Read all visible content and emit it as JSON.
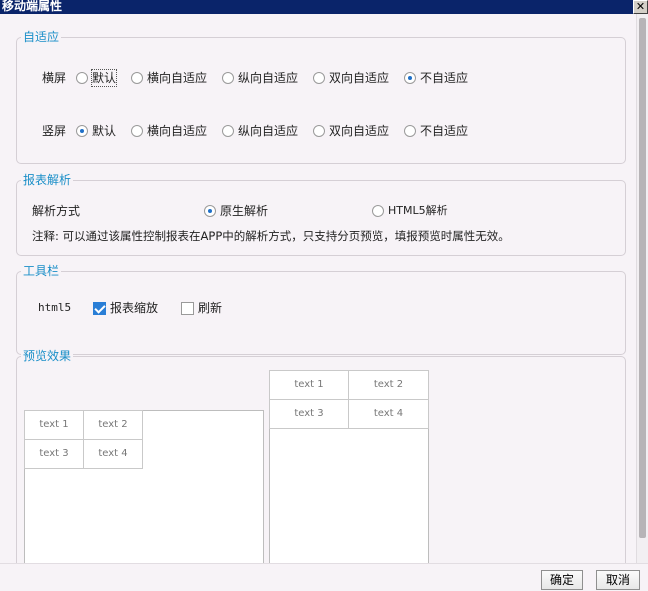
{
  "window": {
    "title": "移动端属性",
    "close_glyph": "✕"
  },
  "adaptive": {
    "title": "自适应",
    "landscape": {
      "label": "横屏",
      "options": [
        "默认",
        "横向自适应",
        "纵向自适应",
        "双向自适应",
        "不自适应"
      ],
      "selected": "不自适应"
    },
    "portrait": {
      "label": "竖屏",
      "options": [
        "默认",
        "横向自适应",
        "纵向自适应",
        "双向自适应",
        "不自适应"
      ],
      "selected": "默认"
    }
  },
  "parse": {
    "title": "报表解析",
    "method_label": "解析方式",
    "options": [
      "原生解析",
      "HTML5解析"
    ],
    "selected": "原生解析",
    "note": "注释: 可以通过该属性控制报表在APP中的解析方式，只支持分页预览，填报预览时属性无效。"
  },
  "toolbar": {
    "title": "工具栏",
    "html5_label": "html5",
    "zoom_label": "报表缩放",
    "zoom_checked": true,
    "refresh_label": "刷新",
    "refresh_checked": false
  },
  "preview": {
    "title": "预览效果",
    "left_cells": [
      "text 1",
      "text 2",
      "text 3",
      "text 4"
    ],
    "right_cells": [
      "text 1",
      "text 2",
      "text 3",
      "text 4"
    ]
  },
  "footer": {
    "ok_label": "确定",
    "cancel_label": "取消"
  }
}
